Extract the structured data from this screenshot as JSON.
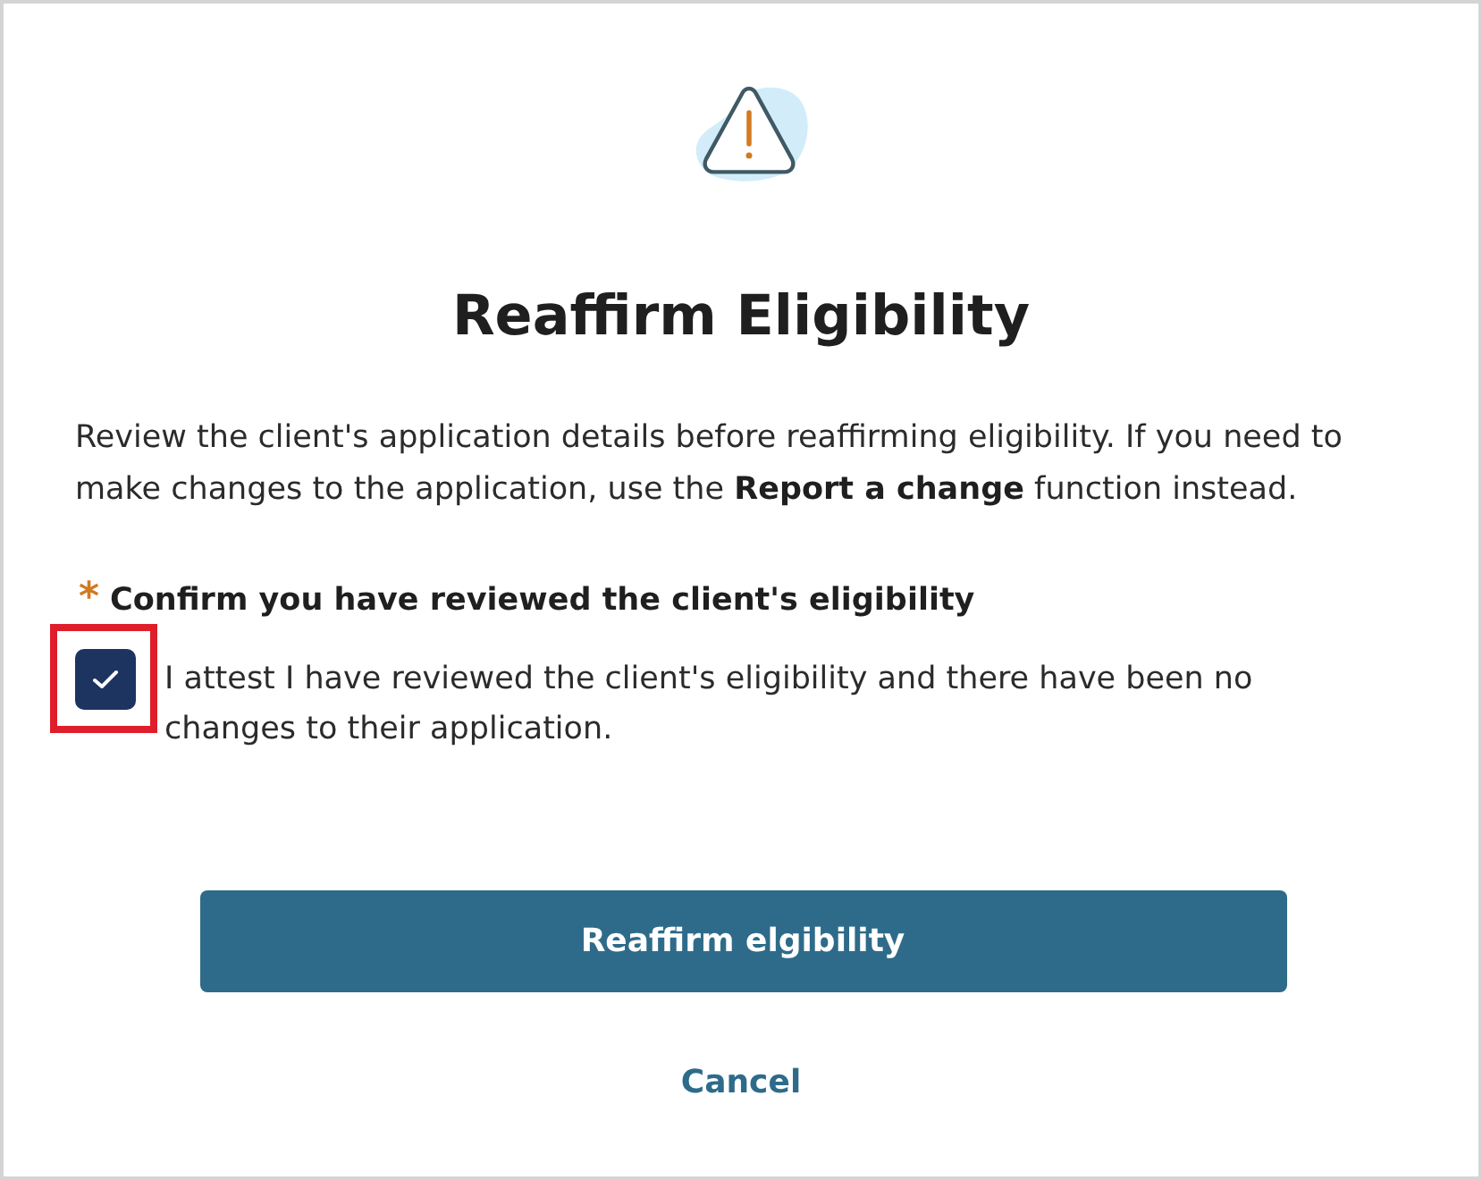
{
  "dialog": {
    "title": "Reaffirm Eligibility",
    "description": "Review the client's application details before reaffirming eligibility. If you need to make changes to the application, use the **Report a change** function instead.",
    "field": {
      "required_mark": "*",
      "label": "Confirm you have reviewed the client's eligibility"
    },
    "attestation": {
      "label": "I attest I have reviewed the client's eligibility and there have been no changes to their application.",
      "checked": true,
      "highlighted": true
    },
    "buttons": [
      {
        "kind": "primary",
        "label": "Reaffirm elgibility"
      },
      {
        "kind": "link",
        "label": "Cancel"
      }
    ]
  }
}
